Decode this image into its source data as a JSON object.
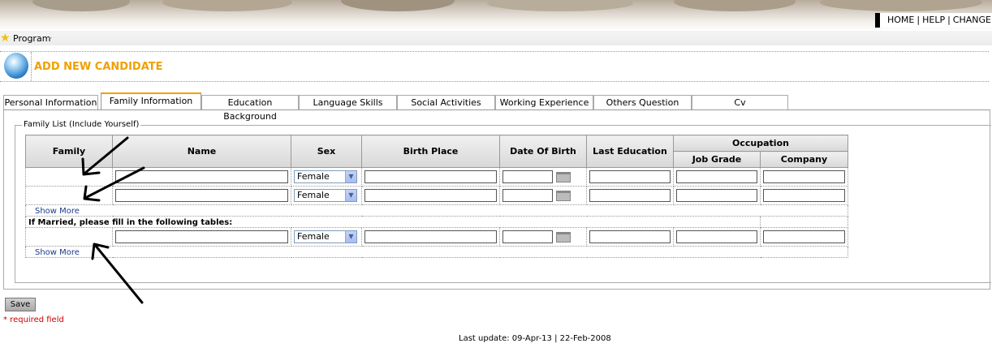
{
  "topnav": {
    "home": "HOME",
    "help": "HELP",
    "change": "CHANGE P"
  },
  "menu": {
    "program": "Program"
  },
  "header": {
    "title": "ADD NEW CANDIDATE"
  },
  "tabs": [
    "Personal Information",
    "Family Information",
    "Education Background",
    "Language Skills",
    "Social Activities",
    "Working Experience",
    "Others Question",
    "Cv"
  ],
  "active_tab": "Family Information",
  "fieldset": {
    "legend": "Family List (Include Yourself)"
  },
  "table": {
    "headers": {
      "family": "Family",
      "name": "Name",
      "sex": "Sex",
      "birth_place": "Birth Place",
      "dob": "Date Of Birth",
      "last_education": "Last Education",
      "occupation": "Occupation",
      "job_grade": "Job Grade",
      "company": "Company"
    },
    "sex_default": "Female",
    "show_more": "Show More",
    "married_note": "If Married, please fill in the following tables:"
  },
  "save_label": "Save",
  "required_note": "* required field",
  "footer": "Last update: 09-Apr-13 | 22-Feb-2008"
}
